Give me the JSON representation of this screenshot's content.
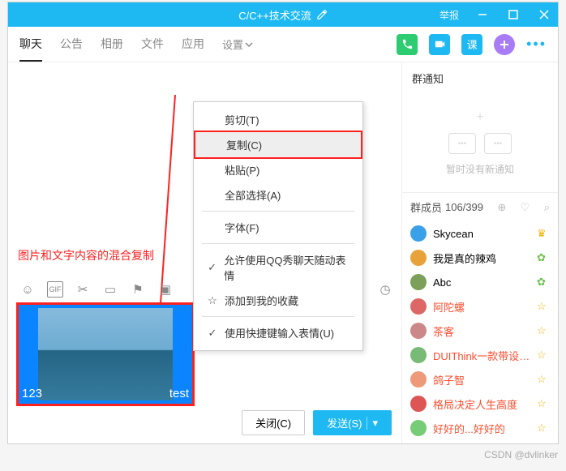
{
  "titlebar": {
    "title": "C/C++技术交流",
    "report": "举报"
  },
  "tabs": {
    "chat": "聊天",
    "notice": "公告",
    "album": "相册",
    "files": "文件",
    "apps": "应用",
    "settings": "设置"
  },
  "toolbar": {
    "course": "课"
  },
  "annotation": "图片和文字内容的混合复制",
  "context_menu": {
    "cut": "剪切(T)",
    "copy": "复制(C)",
    "paste": "粘贴(P)",
    "select_all": "全部选择(A)",
    "font": "字体(F)",
    "allow_qq": "允许使用QQ秀聊天随动表情",
    "add_fav": "添加到我的收藏",
    "shortcut": "使用快捷键输入表情(U)"
  },
  "editor": {
    "left_text": "123",
    "right_text": "test"
  },
  "footer": {
    "close": "关闭(C)",
    "send": "发送(S)"
  },
  "side": {
    "notice_title": "群通知",
    "notice_empty": "暂时没有新通知",
    "members_label": "群成员",
    "members_count": "106/399",
    "members": [
      {
        "name": "Skycean",
        "color": "",
        "role": "owner",
        "avatar": "#3aa0e8"
      },
      {
        "name": "我是真的辣鸡",
        "color": "",
        "role": "admin",
        "avatar": "#e8a23a"
      },
      {
        "name": "Abc",
        "color": "",
        "role": "admin",
        "avatar": "#7aa05a"
      },
      {
        "name": "阿陀螺",
        "color": "red",
        "role": "",
        "avatar": "#d66"
      },
      {
        "name": "茶客",
        "color": "red",
        "role": "",
        "avatar": "#c88"
      },
      {
        "name": "DUIThink一款带设计器的UI",
        "color": "red",
        "role": "",
        "avatar": "#7b7"
      },
      {
        "name": "鸽子智",
        "color": "red",
        "role": "",
        "avatar": "#e97"
      },
      {
        "name": "格局决定人生高度",
        "color": "red",
        "role": "",
        "avatar": "#d55"
      },
      {
        "name": "好好的...好好的",
        "color": "red",
        "role": "",
        "avatar": "#7c7"
      }
    ]
  },
  "watermark": "CSDN @dvlinker"
}
